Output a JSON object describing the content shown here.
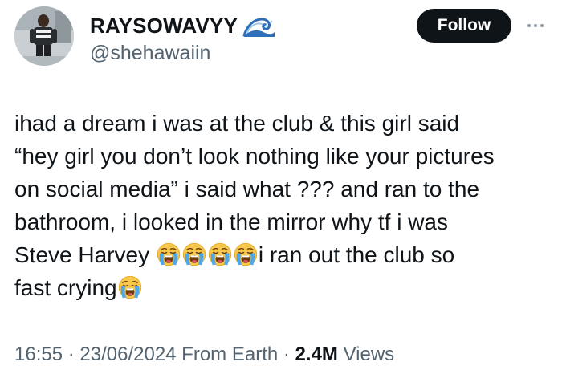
{
  "author": {
    "display_name": "RAYSOWAVYY",
    "handle": "@shehawaiin",
    "name_emoji_icon": "water-wave-icon"
  },
  "actions": {
    "follow_label": "Follow",
    "more_icon": "more-options-icon"
  },
  "tweet": {
    "lines": [
      "ihad a dream i was at the club & this girl said",
      "“hey girl you don’t look nothing like your pictures",
      "on social media” i said what ??? and ran to the",
      "bathroom, i looked in the mirror why tf i was"
    ],
    "line5_before_emoji": "Steve Harvey ",
    "line5_after_emoji": "i ran out the club so",
    "line6_before_emoji": "fast crying",
    "emoji_name": "loudly-crying-face-icon"
  },
  "meta": {
    "time": "16:55",
    "separator1": " · ",
    "date": "23/06/2024",
    "source": " From Earth",
    "separator2": " · ",
    "views_count": "2.4M",
    "views_label": " Views"
  },
  "colors": {
    "text_primary": "#0f1419",
    "text_secondary": "#536471",
    "follow_bg": "#0f1419",
    "follow_text": "#ffffff",
    "emoji_face": "#f8c84a",
    "emoji_tears": "#4fa7e8"
  }
}
